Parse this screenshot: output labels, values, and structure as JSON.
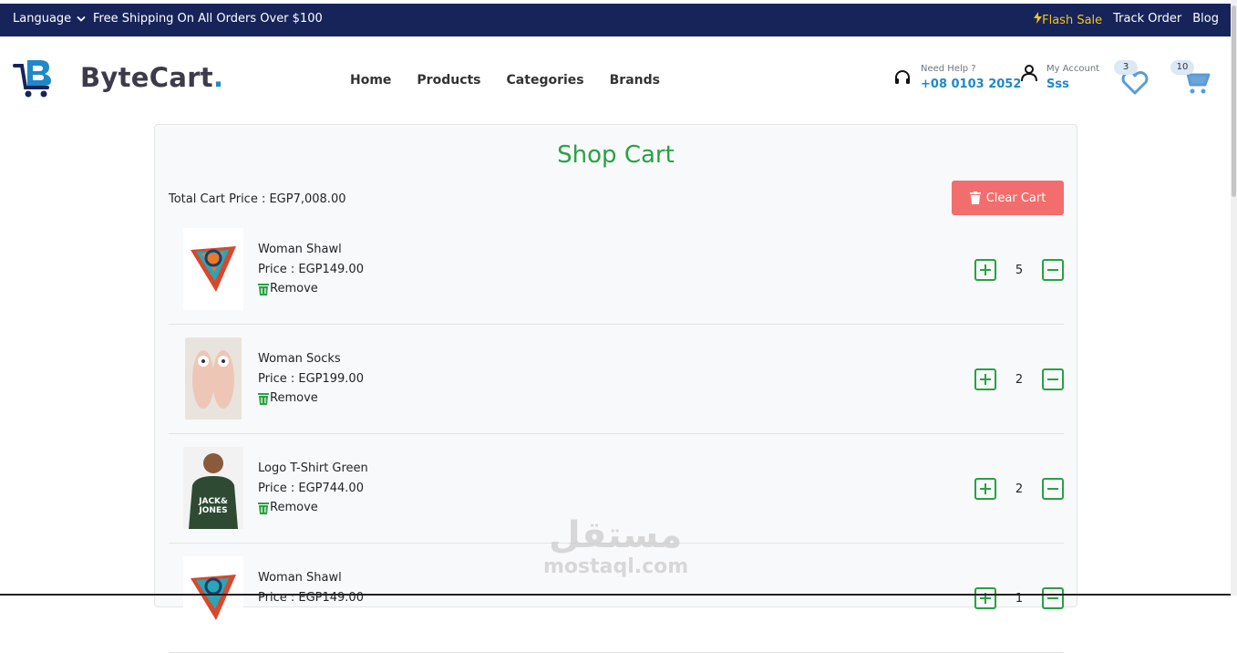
{
  "topbar": {
    "language_label": "Language",
    "shipping_text": "Free Shipping On All Orders Over $100",
    "flash_sale": "Flash Sale",
    "track_order": "Track Order",
    "blog": "Blog"
  },
  "header": {
    "brand": "ByteCart",
    "brand_dot": ".",
    "nav": [
      "Home",
      "Products",
      "Categories",
      "Brands"
    ],
    "help_label": "Need Help ?",
    "help_phone": "+08 0103 2052",
    "account_label": "My Account",
    "account_name": "Sss",
    "wishlist_count": "3",
    "cart_count": "10"
  },
  "cart": {
    "title": "Shop Cart",
    "total": "Total Cart Price : EGP7,008.00",
    "clear_label": "Clear Cart",
    "remove_label": "Remove",
    "items": [
      {
        "name": "Woman Shawl",
        "price": "Price : EGP149.00",
        "qty": "5"
      },
      {
        "name": "Woman Socks",
        "price": "Price : EGP199.00",
        "qty": "2"
      },
      {
        "name": "Logo T-Shirt Green",
        "price": "Price : EGP744.00",
        "qty": "2"
      },
      {
        "name": "Woman Shawl",
        "price": "Price : EGP149.00",
        "qty": "1"
      }
    ]
  },
  "watermark": {
    "latin": "mostaql.com",
    "arabic": "مستقل"
  },
  "colors": {
    "topbar": "#17245a",
    "accent": "#1e88c9",
    "green": "#27a243",
    "clear": "#f26e6e",
    "flash": "#f5c518"
  }
}
